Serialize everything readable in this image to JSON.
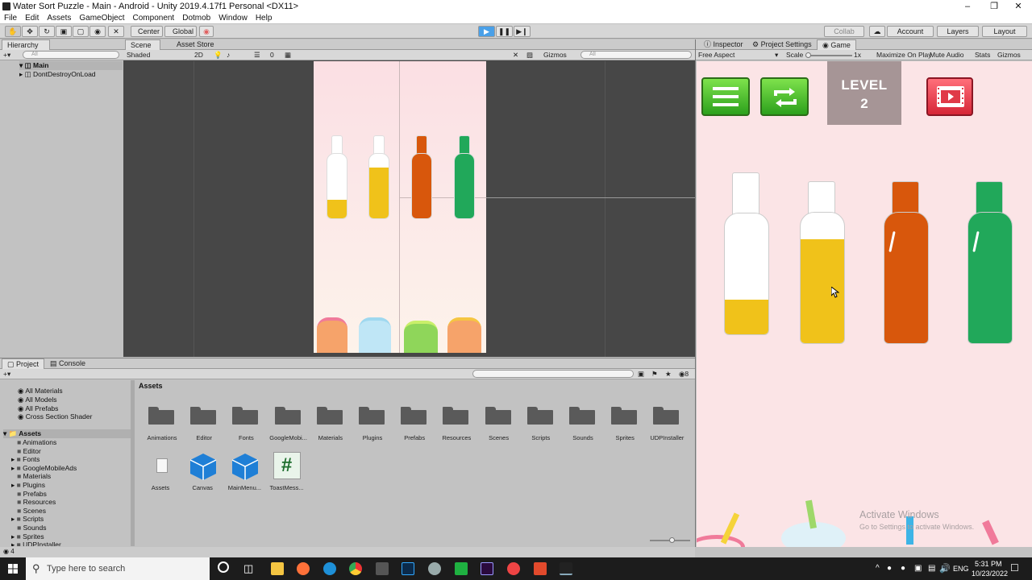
{
  "window": {
    "title": "Water Sort Puzzle - Main - Android - Unity 2019.4.17f1 Personal <DX11>"
  },
  "menu": [
    "File",
    "Edit",
    "Assets",
    "GameObject",
    "Component",
    "Dotmob",
    "Window",
    "Help"
  ],
  "toolbar": {
    "center_label": "Center",
    "global_label": "Global",
    "collab_label": "Collab",
    "account_label": "Account",
    "layers_label": "Layers",
    "layout_label": "Layout"
  },
  "hierarchy": {
    "tab": "Hierarchy",
    "search_placeholder": "All",
    "items": [
      "Main",
      "DontDestroyOnLoad"
    ]
  },
  "scene": {
    "tabs": [
      "Scene",
      "Asset Store"
    ],
    "shading": "Shaded",
    "mode_2d": "2D",
    "fx_count": "0",
    "gizmos": "Gizmos",
    "search_placeholder": "All"
  },
  "inspector_tabs": [
    "Inspector",
    "Project Settings",
    "Game"
  ],
  "game": {
    "aspect": "Free Aspect",
    "scale_label": "Scale",
    "scale_value": "1x",
    "maximize": "Maximize On Play",
    "mute": "Mute Audio",
    "stats": "Stats",
    "gizmos": "Gizmos",
    "level_label": "LEVEL",
    "level_number": "2",
    "watermark_title": "Activate Windows",
    "watermark_sub": "Go to Settings to activate Windows."
  },
  "colors": {
    "yellow": "#f0c21a",
    "orange": "#d8570c",
    "green": "#21a85a",
    "game_bg": "#fbe4e6"
  },
  "project": {
    "tabs": [
      "Project",
      "Console"
    ],
    "breadcrumb": "Assets",
    "count": "8",
    "favorites": [
      "All Materials",
      "All Models",
      "All Prefabs",
      "Cross Section Shader"
    ],
    "tree_root": "Assets",
    "tree": [
      "Animations",
      "Editor",
      "Fonts",
      "GoogleMobileAds",
      "Materials",
      "Plugins",
      "Prefabs",
      "Resources",
      "Scenes",
      "Scripts",
      "Sounds",
      "Sprites",
      "UDPInstaller"
    ],
    "folders": [
      "Animations",
      "Editor",
      "Fonts",
      "GoogleMobi...",
      "Materials",
      "Plugins",
      "Prefabs",
      "Resources",
      "Scenes",
      "Scripts",
      "Sounds",
      "Sprites",
      "UDPInstaller"
    ],
    "files": [
      "Assets",
      "Canvas",
      "MainMenu...",
      "ToastMess..."
    ]
  },
  "status": {
    "count": "4"
  },
  "taskbar": {
    "search_placeholder": "Type here to search",
    "lang": "ENG",
    "time": "5:31 PM",
    "date": "10/23/2022"
  }
}
